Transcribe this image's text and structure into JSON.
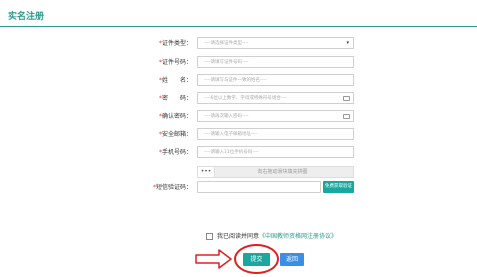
{
  "page": {
    "title": "实名注册"
  },
  "form": {
    "id_type": {
      "label": "证件类型：",
      "placeholder": "----请选择证件类型----"
    },
    "id_number": {
      "label": "证件号码：",
      "placeholder": "----请填写证件号码----"
    },
    "name": {
      "label": "姓　　名：",
      "placeholder": "----请填写与证件一致的姓名----"
    },
    "password": {
      "label": "密　　码：",
      "placeholder": "----6位以上数字、字母或特殊符号组合----"
    },
    "confirm_password": {
      "label": "确认密码：",
      "placeholder": "----请再次输入密码----"
    },
    "email": {
      "label": "安全邮箱：",
      "placeholder": "----请输入电子邮箱地址----"
    },
    "phone": {
      "label": "手机号码：",
      "placeholder": "----请输入11位手机号码----"
    },
    "slider": {
      "handle": "•••",
      "text": "向右拖动滑块填充拼图"
    },
    "sms": {
      "label": "短信验证码：",
      "button": "免费获取验证码"
    },
    "agreement": {
      "text": "我已阅读并同意",
      "link": "《中国教师资格网注册协议》"
    },
    "submit": "提交",
    "back": "返回"
  },
  "colors": {
    "primary": "#1aa79f",
    "secondary": "#3b8ee6",
    "annotation": "#e02020"
  }
}
